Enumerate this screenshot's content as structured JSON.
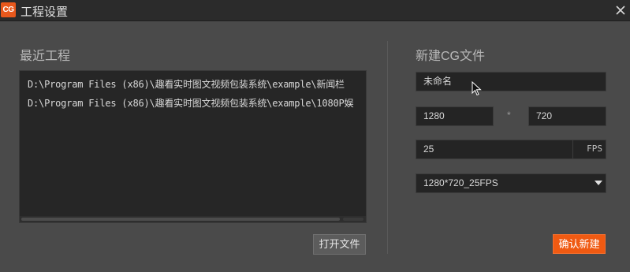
{
  "window": {
    "logo_text": "CG",
    "title": "工程设置",
    "close_icon": "close-icon"
  },
  "recent": {
    "title": "最近工程",
    "items": [
      "D:\\Program Files (x86)\\趣看实时图文视频包装系统\\example\\新闻栏",
      "D:\\Program Files (x86)\\趣看实时图文视频包装系统\\example\\1080P娱"
    ],
    "open_button": "打开文件"
  },
  "new_file": {
    "title": "新建CG文件",
    "name_value": "未命名",
    "width_value": "1280",
    "times_sign": "*",
    "height_value": "720",
    "fps_value": "25",
    "fps_unit": "FPS",
    "preset_selected": "1280*720_25FPS",
    "confirm_button": "确认新建"
  },
  "colors": {
    "accent": "#f05a12",
    "background": "#4a4a4a",
    "field_bg": "#242424"
  }
}
